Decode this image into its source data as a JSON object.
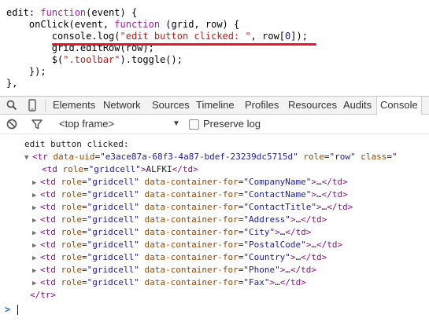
{
  "code": {
    "lines": [
      {
        "segments": [
          {
            "t": "edit: ",
            "c": ""
          },
          {
            "t": "function",
            "c": "kw"
          },
          {
            "t": "(event) {",
            "c": ""
          }
        ]
      },
      {
        "segments": [
          {
            "t": "    onClick(event, ",
            "c": ""
          },
          {
            "t": "function",
            "c": "kw"
          },
          {
            "t": " (grid, row) {",
            "c": ""
          }
        ]
      },
      {
        "segments": [
          {
            "t": "        console.log(",
            "c": ""
          },
          {
            "t": "\"edit button clicked: \"",
            "c": "str"
          },
          {
            "t": ", row[",
            "c": ""
          },
          {
            "t": "0",
            "c": "num"
          },
          {
            "t": "]);",
            "c": ""
          }
        ]
      },
      {
        "segments": [
          {
            "t": "        grid.editRow(row);",
            "c": ""
          }
        ]
      },
      {
        "segments": [
          {
            "t": "        $(",
            "c": ""
          },
          {
            "t": "\".toolbar\"",
            "c": "str"
          },
          {
            "t": ").toggle();",
            "c": ""
          }
        ]
      },
      {
        "segments": [
          {
            "t": "    });",
            "c": ""
          }
        ]
      },
      {
        "segments": [
          {
            "t": "},",
            "c": ""
          }
        ]
      }
    ]
  },
  "devtools": {
    "tabs": [
      "Elements",
      "Network",
      "Sources",
      "Timeline",
      "Profiles",
      "Resources",
      "Audits",
      "Console"
    ],
    "active_tab": "Console",
    "frame_select": "<top frame>",
    "preserve_log_label": "Preserve log",
    "preserve_log_checked": false
  },
  "console": {
    "log_message": "edit button clicked:",
    "tr_open": {
      "tag": "tr",
      "attrs": [
        {
          "name": "data-uid",
          "value": "\"e3ace87a-68f3-4a87-bdef-23239dc5715d\""
        },
        {
          "name": "role",
          "value": "\"row\""
        },
        {
          "name": "class",
          "value": "\""
        }
      ]
    },
    "first_cell": {
      "role": "\"gridcell\"",
      "text": "ALFKI"
    },
    "cells": [
      {
        "for": "\"CompanyName\""
      },
      {
        "for": "\"ContactName\""
      },
      {
        "for": "\"ContactTitle\""
      },
      {
        "for": "\"Address\""
      },
      {
        "for": "\"City\""
      },
      {
        "for": "\"PostalCode\""
      },
      {
        "for": "\"Country\""
      },
      {
        "for": "\"Phone\""
      },
      {
        "for": "\"Fax\""
      }
    ],
    "cell_role": "\"gridcell\"",
    "cell_attr_name": "data-container-for",
    "ellipsis": "…",
    "tr_close": "</tr>",
    "prompt": ">"
  },
  "colors": {
    "underline": "#e8152a",
    "tag": "#881280",
    "attr": "#994500",
    "value": "#1a1aa6",
    "prompt": "#1b6fd6"
  },
  "icons": [
    "search-icon",
    "device-mode-icon",
    "clear-console-icon",
    "filter-icon",
    "dropdown-arrow-icon",
    "expand-triangle-icon",
    "prompt-chevron-icon"
  ]
}
